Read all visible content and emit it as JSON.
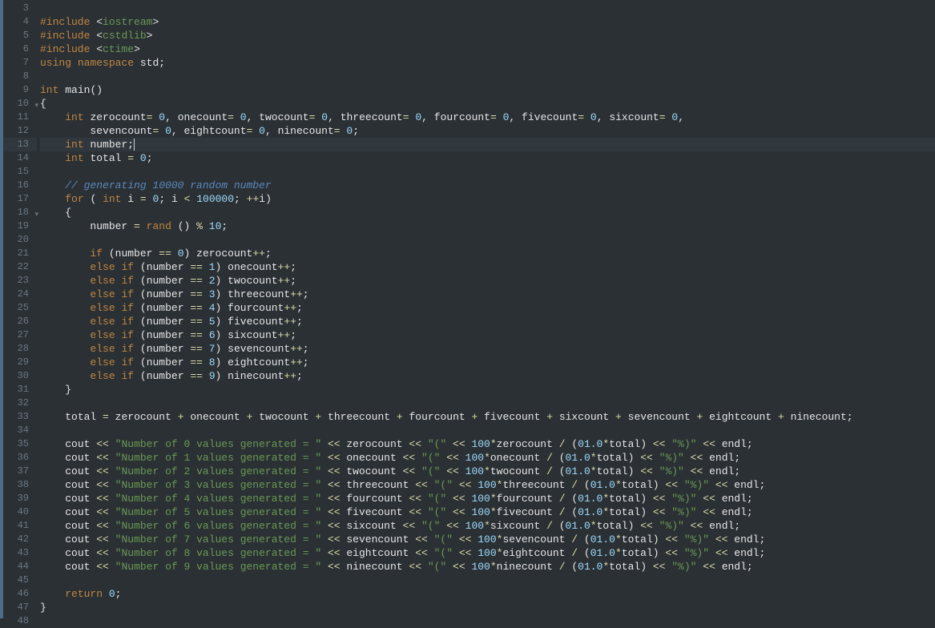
{
  "gutter": {
    "start": 3,
    "end": 48,
    "foldLines": [
      10,
      18
    ]
  },
  "highlightLine": 13,
  "tokens": {
    "include": "#include",
    "lt": "<",
    "gt": ">",
    "iostream": "iostream",
    "cstdlib": "cstdlib",
    "ctime": "ctime",
    "using": "using",
    "namespace": "namespace",
    "std": "std",
    "semi": ";",
    "int": "int",
    "main": "main",
    "lp": "(",
    "rp": ")",
    "lb": "{",
    "rb": "}",
    "zerocount": "zerocount",
    "onecount": "onecount",
    "twocount": "twocount",
    "threecount": "threecount",
    "fourcount": "fourcount",
    "fivecount": "fivecount",
    "sixcount": "sixcount",
    "sevencount": "sevencount",
    "eightcount": "eightcount",
    "ninecount": "ninecount",
    "eq": "=",
    "zero": "0",
    "comma": ",",
    "number": "number",
    "total": "total",
    "comment1": "// generating 10000 random number",
    "for": "for",
    "i": "i",
    "ltop": "<",
    "hundredk": "100000",
    "ppinc": "++",
    "rand": "rand",
    "pct": "%",
    "ten": "10",
    "if": "if",
    "eqeq": "==",
    "else": "else",
    "n0": "0",
    "n1": "1",
    "n2": "2",
    "n3": "3",
    "n4": "4",
    "n5": "5",
    "n6": "6",
    "n7": "7",
    "n8": "8",
    "n9": "9",
    "plus": "+",
    "cout": "cout",
    "ltlt": "<<",
    "str_num0": "\"Number of 0 values generated = \"",
    "str_num1": "\"Number of 1 values generated = \"",
    "str_num2": "\"Number of 2 values generated = \"",
    "str_num3": "\"Number of 3 values generated = \"",
    "str_num4": "\"Number of 4 values generated = \"",
    "str_num5": "\"Number of 5 values generated = \"",
    "str_num6": "\"Number of 6 values generated = \"",
    "str_num7": "\"Number of 7 values generated = \"",
    "str_num8": "\"Number of 8 values generated = \"",
    "str_num9": "\"Number of 9 values generated = \"",
    "str_lp": "\"(\"",
    "str_pct": "\"%)\"",
    "hundred": "100",
    "star": "*",
    "slash": "/",
    "one_f": "01.0",
    "endl": "endl",
    "return": "return"
  }
}
